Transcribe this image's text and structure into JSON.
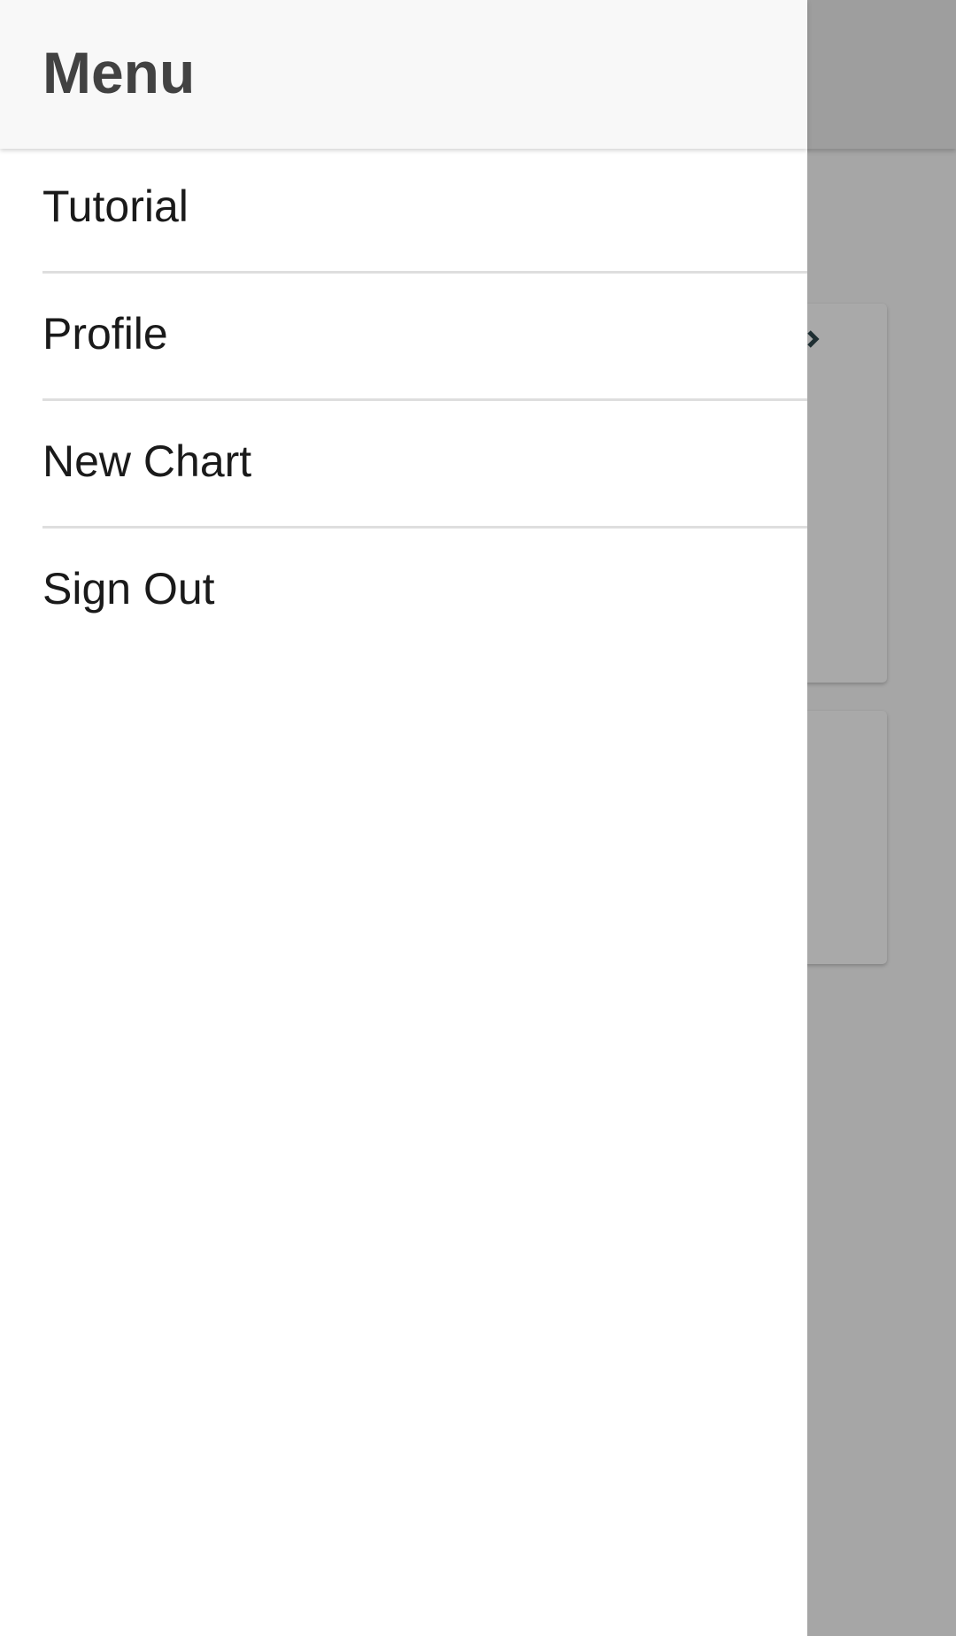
{
  "drawer": {
    "title": "Menu",
    "items": [
      {
        "label": "Tutorial"
      },
      {
        "label": "Profile"
      },
      {
        "label": "New Chart"
      },
      {
        "label": "Sign Out"
      }
    ]
  },
  "background": {
    "card_icon": "chevron-right-icon"
  },
  "colors": {
    "scrim": "#a6a6a6",
    "drawer_header": "#f8f8f8",
    "title_text": "#424242",
    "item_text": "#1a1a1a",
    "divider": "#dedede"
  }
}
